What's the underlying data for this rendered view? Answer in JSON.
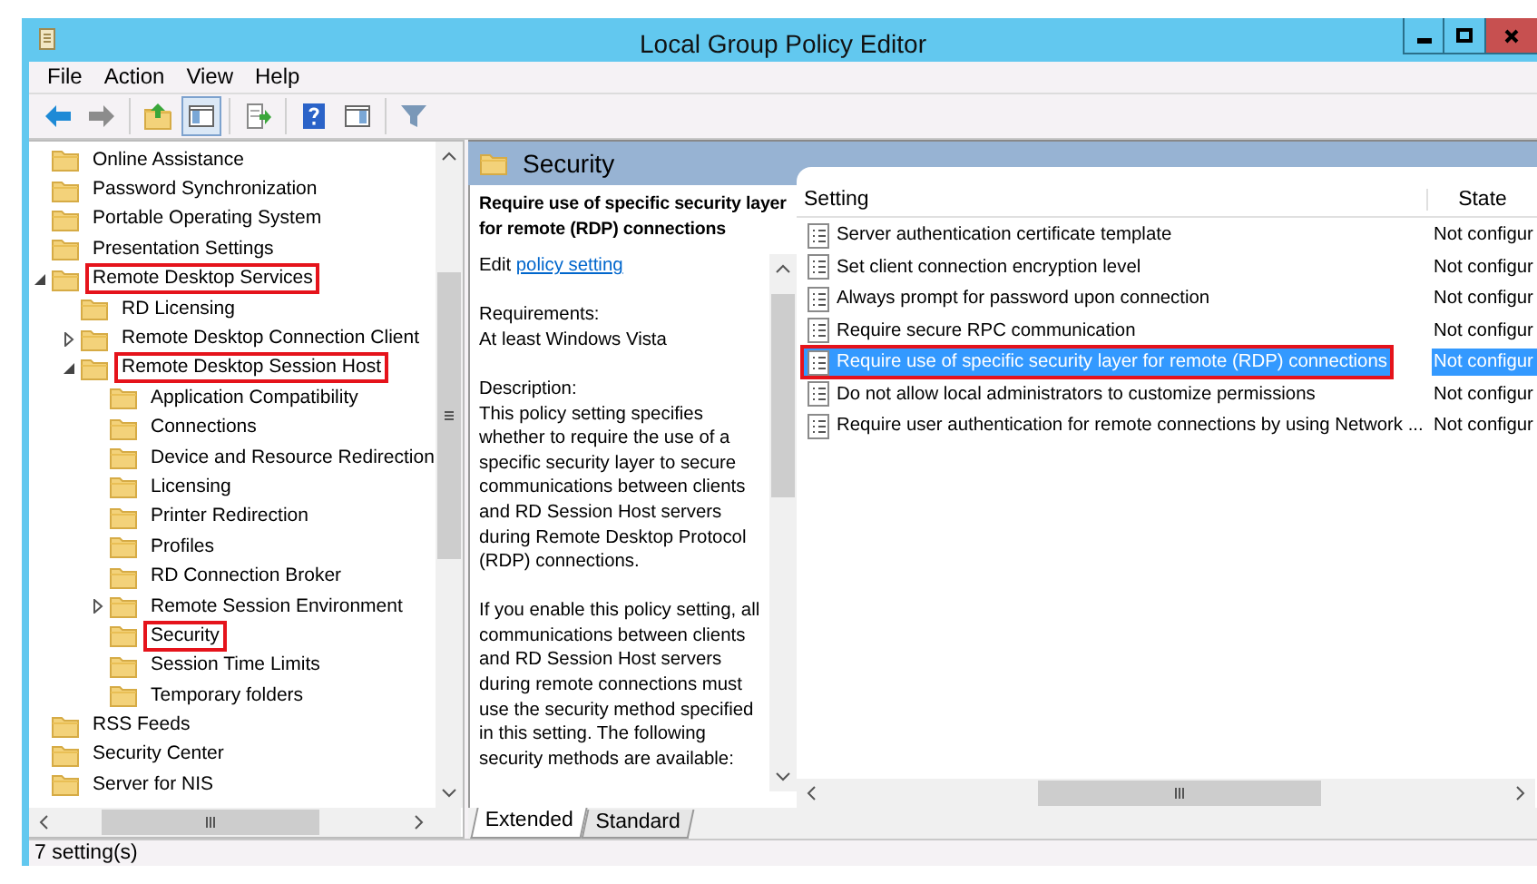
{
  "window": {
    "title": "Local Group Policy Editor"
  },
  "menu": [
    "File",
    "Action",
    "View",
    "Help"
  ],
  "toolbar": [
    {
      "kind": "back",
      "pressed": false
    },
    {
      "kind": "forward",
      "pressed": false
    },
    {
      "kind": "up",
      "pressed": false
    },
    {
      "kind": "tree",
      "pressed": true
    },
    {
      "kind": "export",
      "pressed": false
    },
    {
      "kind": "help",
      "pressed": false
    },
    {
      "kind": "view",
      "pressed": false
    },
    {
      "kind": "filter",
      "pressed": false
    }
  ],
  "tree": [
    {
      "label": "Online Assistance",
      "outlined": false
    },
    {
      "label": "Password Synchronization",
      "outlined": false
    },
    {
      "label": "Portable Operating System",
      "outlined": false
    },
    {
      "label": "Presentation Settings",
      "outlined": false
    },
    {
      "label": "Remote Desktop Services",
      "outlined": true,
      "expanded": true,
      "children": [
        {
          "label": "RD Licensing",
          "outlined": false
        },
        {
          "label": "Remote Desktop Connection Client",
          "outlined": false,
          "expanded": false
        },
        {
          "label": "Remote Desktop Session Host",
          "outlined": true,
          "expanded": true,
          "children": [
            {
              "label": "Application Compatibility",
              "outlined": false
            },
            {
              "label": "Connections",
              "outlined": false
            },
            {
              "label": "Device and Resource Redirection",
              "outlined": false
            },
            {
              "label": "Licensing",
              "outlined": false
            },
            {
              "label": "Printer Redirection",
              "outlined": false
            },
            {
              "label": "Profiles",
              "outlined": false
            },
            {
              "label": "RD Connection Broker",
              "outlined": false
            },
            {
              "label": "Remote Session Environment",
              "outlined": false,
              "expanded": false
            },
            {
              "label": "Security",
              "outlined": true
            },
            {
              "label": "Session Time Limits",
              "outlined": false
            },
            {
              "label": "Temporary folders",
              "outlined": false
            }
          ]
        }
      ]
    },
    {
      "label": "RSS Feeds",
      "outlined": false
    },
    {
      "label": "Security Center",
      "outlined": false
    },
    {
      "label": "Server for NIS",
      "outlined": false
    }
  ],
  "panel_header": "Security",
  "detail": {
    "title": "Require use of specific security layer for remote (RDP) connections",
    "edit_prefix": "Edit",
    "edit_link": "policy setting",
    "requirements_label": "Requirements:",
    "requirements": "At least Windows Vista",
    "description_label": "Description:",
    "paragraphs": [
      "This policy setting specifies whether to require the use of a specific security layer to secure communications between clients and RD Session Host servers during Remote Desktop Protocol (RDP) connections.",
      "If you enable this policy setting, all communications between clients and RD Session Host servers during remote connections must use the security method specified in this setting. The following security methods are available:"
    ]
  },
  "table": {
    "columns": [
      "Setting",
      "State"
    ],
    "rows": [
      {
        "setting": "Server authentication certificate template",
        "state": "Not configur",
        "selected": false,
        "outlined": false
      },
      {
        "setting": "Set client connection encryption level",
        "state": "Not configur",
        "selected": false,
        "outlined": false
      },
      {
        "setting": "Always prompt for password upon connection",
        "state": "Not configur",
        "selected": false,
        "outlined": false
      },
      {
        "setting": "Require secure RPC communication",
        "state": "Not configur",
        "selected": false,
        "outlined": false
      },
      {
        "setting": "Require use of specific security layer for remote (RDP) connections",
        "state": "Not configur",
        "selected": true,
        "outlined": true
      },
      {
        "setting": "Do not allow local administrators to customize permissions",
        "state": "Not configur",
        "selected": false,
        "outlined": false
      },
      {
        "setting": "Require user authentication for remote connections by using Network ...",
        "state": "Not configur",
        "selected": false,
        "outlined": false
      }
    ]
  },
  "tabs": [
    {
      "label": "Extended",
      "selected": true
    },
    {
      "label": "Standard",
      "selected": false
    }
  ],
  "status_bar": "7 setting(s)"
}
